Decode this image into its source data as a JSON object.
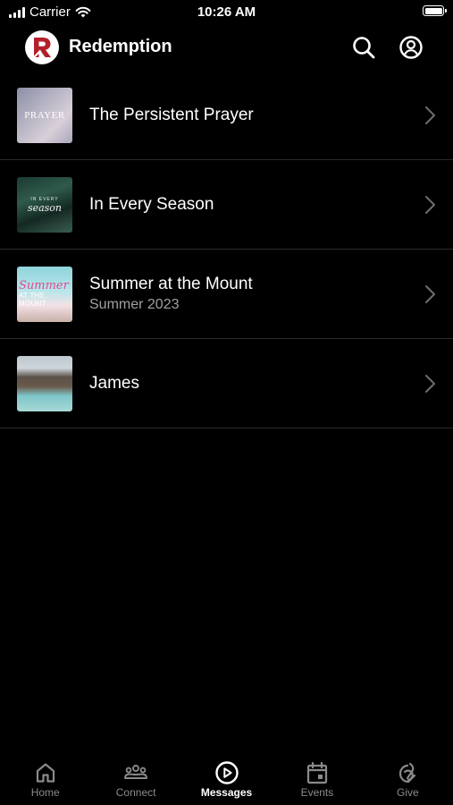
{
  "status_bar": {
    "carrier": "Carrier",
    "time": "10:26 AM"
  },
  "header": {
    "app_name": "Redemption",
    "logo_letter": "R"
  },
  "series": [
    {
      "title": "The Persistent Prayer",
      "subtitle": "",
      "thumbnail_text": "PRAYER"
    },
    {
      "title": "In Every Season",
      "subtitle": "",
      "thumbnail_text_small": "IN EVERY",
      "thumbnail_text_script": "season"
    },
    {
      "title": "Summer at the Mount",
      "subtitle": "Summer 2023",
      "thumbnail_text_script": "Summer",
      "thumbnail_text_small": "AT THE MOUNT"
    },
    {
      "title": "James",
      "subtitle": ""
    }
  ],
  "tabs": [
    {
      "label": "Home",
      "icon": "home-icon",
      "active": false
    },
    {
      "label": "Connect",
      "icon": "people-icon",
      "active": false
    },
    {
      "label": "Messages",
      "icon": "play-circle-icon",
      "active": true
    },
    {
      "label": "Events",
      "icon": "calendar-icon",
      "active": false
    },
    {
      "label": "Give",
      "icon": "give-icon",
      "active": false
    }
  ],
  "colors": {
    "background": "#000000",
    "logo_red": "#b3202a",
    "inactive_tab": "#8a8a8a",
    "active_tab": "#ffffff"
  }
}
